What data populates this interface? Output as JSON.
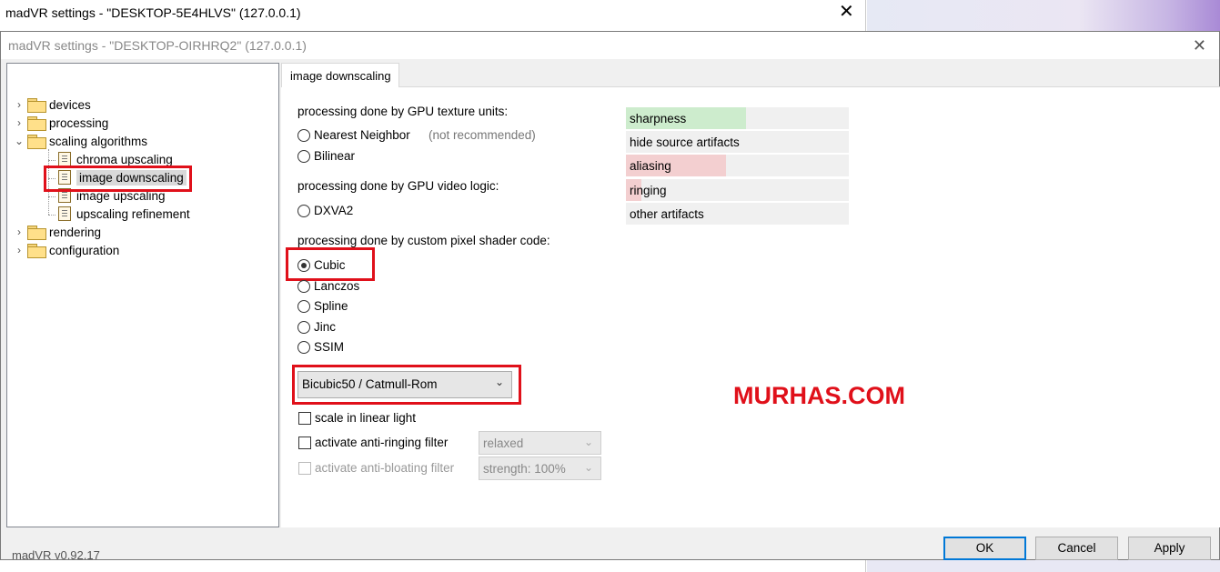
{
  "background_window": {
    "title": "madVR settings - \"DESKTOP-5E4HLVS\" (127.0.0.1)",
    "close_glyph": "✕"
  },
  "dialog": {
    "title": "madVR settings - \"DESKTOP-OIRHRQ2\" (127.0.0.1)",
    "close_glyph": "✕"
  },
  "tree": {
    "items": [
      {
        "label": "devices",
        "icon": "folder-icon",
        "expander": "›"
      },
      {
        "label": "processing",
        "icon": "folder-icon",
        "expander": "›"
      },
      {
        "label": "scaling algorithms",
        "icon": "folder-icon",
        "expander": "⌄"
      },
      {
        "label": "chroma upscaling",
        "icon": "page-icon"
      },
      {
        "label": "image downscaling",
        "icon": "page-icon",
        "selected": true
      },
      {
        "label": "image upscaling",
        "icon": "page-icon"
      },
      {
        "label": "upscaling refinement",
        "icon": "page-icon"
      },
      {
        "label": "rendering",
        "icon": "folder-icon",
        "expander": "›"
      },
      {
        "label": "configuration",
        "icon": "folder-icon",
        "expander": "›"
      }
    ]
  },
  "tab": {
    "label": "image downscaling"
  },
  "content": {
    "gpu_texture_label": "processing done by GPU texture units:",
    "nearest_neighbor": "Nearest Neighbor",
    "not_recommended": "(not recommended)",
    "bilinear": "Bilinear",
    "gpu_video_label": "processing done by GPU video logic:",
    "dxva2": "DXVA2",
    "pixel_shader_label": "processing done by custom pixel shader code:",
    "cubic": "Cubic",
    "lanczos": "Lanczos",
    "spline": "Spline",
    "jinc": "Jinc",
    "ssim": "SSIM",
    "selected_algorithm": "Cubic",
    "filter_select": "Bicubic50 / Catmull-Rom",
    "scale_linear": "scale in linear light",
    "anti_ringing": "activate anti-ringing filter",
    "anti_ringing_select": "relaxed",
    "anti_bloating": "activate anti-bloating filter",
    "anti_bloating_select": "strength: 100%"
  },
  "quality": [
    {
      "label": "sharpness",
      "color": "#cdeccd",
      "level": 0.54
    },
    {
      "label": "hide source artifacts",
      "color": "#f0f0f0",
      "level": 0
    },
    {
      "label": "aliasing",
      "color": "#f3cfd0",
      "level": 0.45
    },
    {
      "label": "ringing",
      "color": "#f3cfd0",
      "level": 0.07
    },
    {
      "label": "other artifacts",
      "color": "#f0f0f0",
      "level": 0
    }
  ],
  "watermark": "MURHAS.COM",
  "footer": {
    "version": "madVR v0.92.17",
    "ok": "OK",
    "cancel": "Cancel",
    "apply": "Apply"
  },
  "colors": {
    "highlight_box": "#e0101a",
    "default_button_border": "#0078d7"
  }
}
